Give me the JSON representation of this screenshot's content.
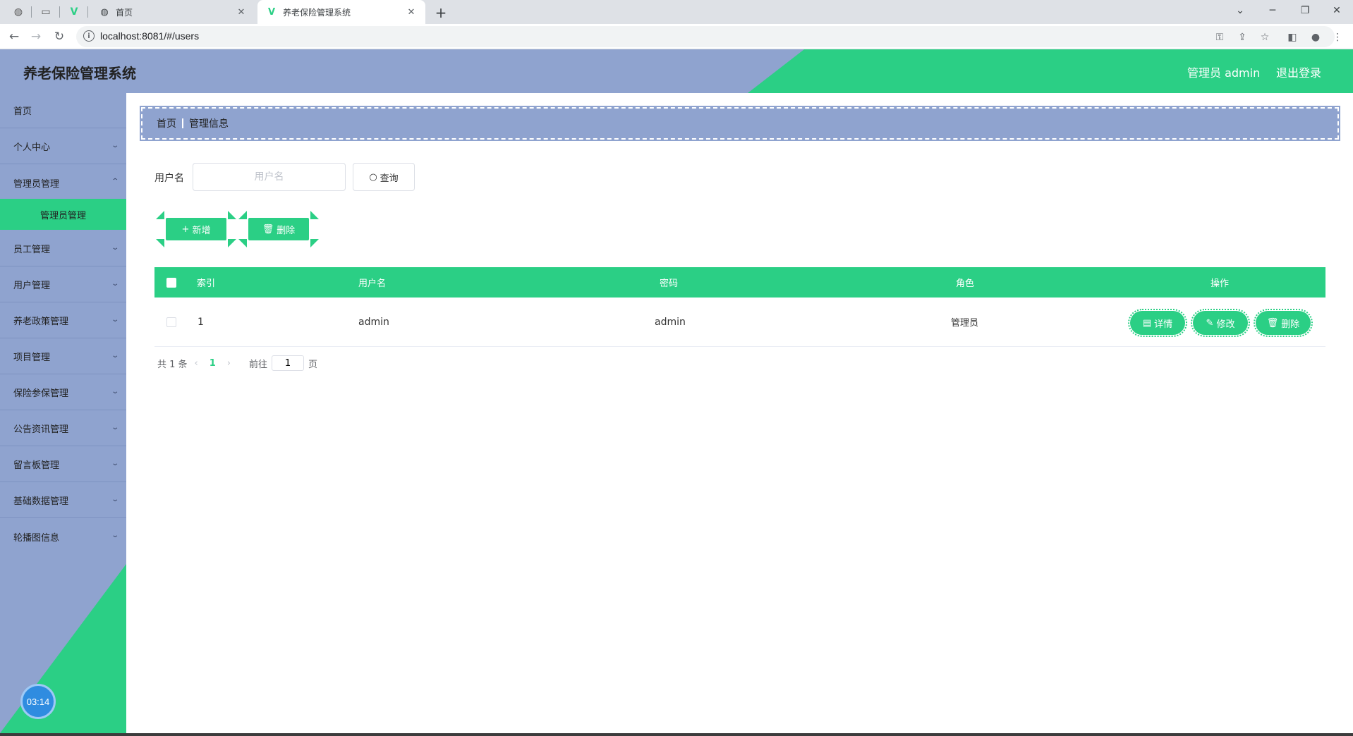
{
  "browser": {
    "tabs": [
      {
        "title": "首页",
        "close": "✕"
      },
      {
        "title": "养老保险管理系统",
        "close": "✕"
      }
    ],
    "new_tab": "+",
    "url": "localhost:8081/#/users",
    "window_controls": [
      "⌄",
      "─",
      "❐",
      "✕"
    ]
  },
  "header": {
    "title": "养老保险管理系统",
    "user": "管理员 admin",
    "logout": "退出登录"
  },
  "sidebar": {
    "items": [
      {
        "label": "首页"
      },
      {
        "label": "个人中心"
      },
      {
        "label": "管理员管理"
      },
      {
        "label": "员工管理"
      },
      {
        "label": "用户管理"
      },
      {
        "label": "养老政策管理"
      },
      {
        "label": "项目管理"
      },
      {
        "label": "保险参保管理"
      },
      {
        "label": "公告资讯管理"
      },
      {
        "label": "留言板管理"
      },
      {
        "label": "基础数据管理"
      },
      {
        "label": "轮播图信息"
      }
    ],
    "active_sub": "管理员管理",
    "timer": "03:14"
  },
  "breadcrumb": {
    "home": "首页",
    "current": "管理信息"
  },
  "search": {
    "label": "用户名",
    "placeholder": "用户名",
    "value": "",
    "button": "查询"
  },
  "actions": {
    "add": "新增",
    "delete": "删除"
  },
  "table": {
    "columns": [
      "索引",
      "用户名",
      "密码",
      "角色",
      "操作"
    ],
    "rows": [
      {
        "index": "1",
        "username": "admin",
        "password": "admin",
        "role": "管理员"
      }
    ],
    "row_actions": {
      "detail": "详情",
      "edit": "修改",
      "delete": "删除"
    }
  },
  "pagination": {
    "total": "共 1 条",
    "current": "1",
    "goto": "前往",
    "goto_value": "1",
    "page_unit": "页"
  },
  "colors": {
    "accent": "#2bcf85",
    "sidebar": "#8fa3cf"
  }
}
